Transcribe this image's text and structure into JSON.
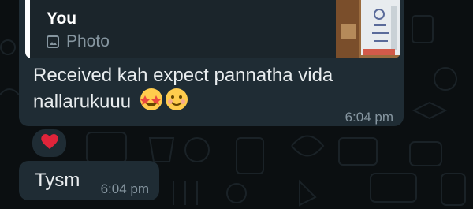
{
  "quoted_message": {
    "author": "You",
    "type_icon": "image-icon",
    "type_label": "Photo"
  },
  "messages": [
    {
      "text": "Received kah expect pannatha vida nallarukuuu",
      "emojis": [
        "star-struck-emoji",
        "smiling-emoji"
      ],
      "time": "6:04 pm",
      "reaction": "red-heart-emoji"
    },
    {
      "text": "Tysm",
      "time": "6:04 pm"
    }
  ],
  "colors": {
    "background": "#0b0f11",
    "bubble": "#1f2c34",
    "quote_bar": "#ffffff",
    "text": "#e9edef",
    "meta": "#8696a0",
    "heart": "#e0243a"
  }
}
